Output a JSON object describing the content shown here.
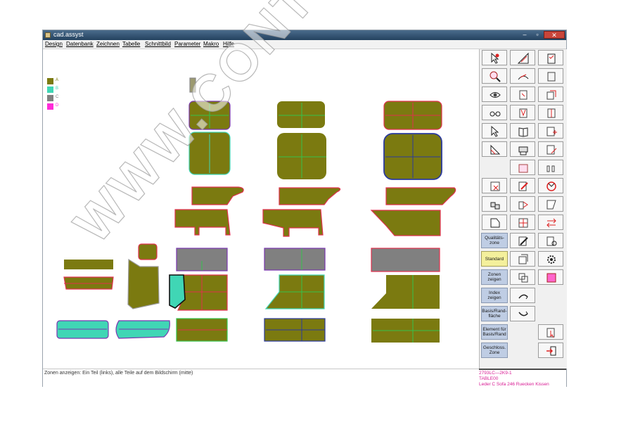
{
  "window": {
    "title": "cad.assyst",
    "minimize_glyph": "–",
    "maximize_glyph": "▫",
    "close_glyph": "✕"
  },
  "menu": [
    "Design",
    "Datenbank",
    "Zeichnen",
    "Tabelle",
    "Schnittbild",
    "Parameter",
    "Makro",
    "Hilfe"
  ],
  "legend": [
    {
      "label": "A",
      "color": "#7b7a10"
    },
    {
      "label": "B",
      "color": "#40d6b5"
    },
    {
      "label": "C",
      "color": "#808080"
    },
    {
      "label": "D",
      "color": "#ff2bd8"
    }
  ],
  "colors": {
    "piece_fill": "#7b7a10",
    "teal": "#40d6b5",
    "grey": "#808080",
    "magenta": "#ff2bd8",
    "seam_red": "#e1304d",
    "seam_green": "#35c24b",
    "edge_blue": "#2b3a9c",
    "edge_purple": "#7a36b0"
  },
  "toolbar": {
    "icons": [
      "cursor-select-icon",
      "ruler-triangle-icon",
      "checklist-icon",
      "magnify-icon",
      "pen-curve-icon",
      "cut-piece-icon",
      "eye-icon",
      "piece-corner-icon",
      "piece-stack-icon",
      "glasses-icon",
      "piece-v-icon",
      "piece-split-icon",
      "cursor-plus-icon",
      "book-icon",
      "piece-plus-icon",
      "ruler-angle-icon",
      "plotter-icon",
      "piece-edit-icon",
      "piece-hatch-icon",
      "piece-notch-icon",
      "piece-remove-icon",
      "piece-pencil-icon",
      "rotate-icon",
      "cubes-icon",
      "piece-mirror-icon",
      "piece-fold-icon",
      "piece-outline-icon",
      "piece-grid-icon",
      "swap-arrows-icon",
      "pencil-draw-icon",
      "piece-gear-icon",
      "piece-layers-icon",
      "settings-icon",
      "piece-duplicate-icon",
      "piece-red-icon",
      "curve-arrow-up-icon",
      "curve-arrow-down-icon",
      "cursor-piece-icon",
      "exit-door-icon"
    ],
    "text_buttons": [
      "Qualitäts-zone",
      "Standard",
      "Zonen zeigen",
      "Index zeigen",
      "Basis/Rand-fläche",
      "Element für Basis/Rand",
      "Geschloss. Zone"
    ]
  },
  "status": {
    "message": "Zonen anzeigen: Ein Teil (links), alle Teile auf dem Bildschirm (mitte)"
  },
  "info": {
    "line1": "2793LC—2K9-1",
    "line2": "TABLE00",
    "line3": "Leder C Sofa 246 Ruecken Kissen"
  },
  "watermark": "WWW.CONTEC.PL"
}
